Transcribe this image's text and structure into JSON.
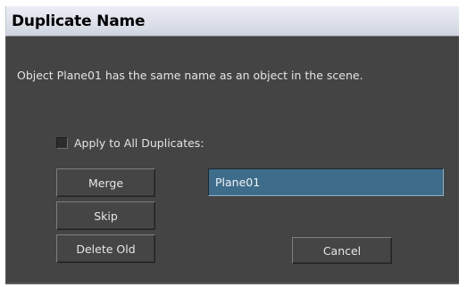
{
  "dialog": {
    "title": "Duplicate Name",
    "message": "Object Plane01 has the same name as an object in the scene.",
    "apply_all": {
      "label": "Apply to All Duplicates:",
      "checked": false
    },
    "buttons": {
      "merge": "Merge",
      "skip": "Skip",
      "delete_old": "Delete Old",
      "cancel": "Cancel"
    },
    "name_field": {
      "value": "Plane01"
    }
  },
  "colors": {
    "body_background": "#444444",
    "input_background": "#3e6d8b",
    "text": "#e4e4e4"
  }
}
